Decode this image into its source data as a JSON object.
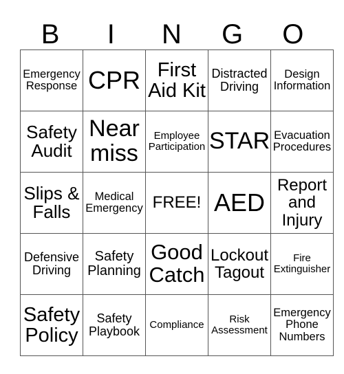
{
  "header": {
    "letters": [
      "B",
      "I",
      "N",
      "G",
      "O"
    ]
  },
  "grid": {
    "rows": [
      [
        "Emergency\nResponse",
        "CPR",
        "First\nAid Kit",
        "Distracted\nDriving",
        "Design\nInformation"
      ],
      [
        "Safety\nAudit",
        "Near\nmiss",
        "Employee\nParticipation",
        "STAR",
        "Evacuation\nProcedures"
      ],
      [
        "Slips &\nFalls",
        "Medical\nEmergency",
        "FREE!",
        "AED",
        "Report\nand\nInjury"
      ],
      [
        "Defensive\nDriving",
        "Safety\nPlanning",
        "Good\nCatch",
        "Lockout\nTagout",
        "Fire\nExtinguisher"
      ],
      [
        "Safety\nPolicy",
        "Safety\nPlaybook",
        "Compliance",
        "Risk\nAssessment",
        "Emergency\nPhone\nNumbers"
      ]
    ]
  }
}
